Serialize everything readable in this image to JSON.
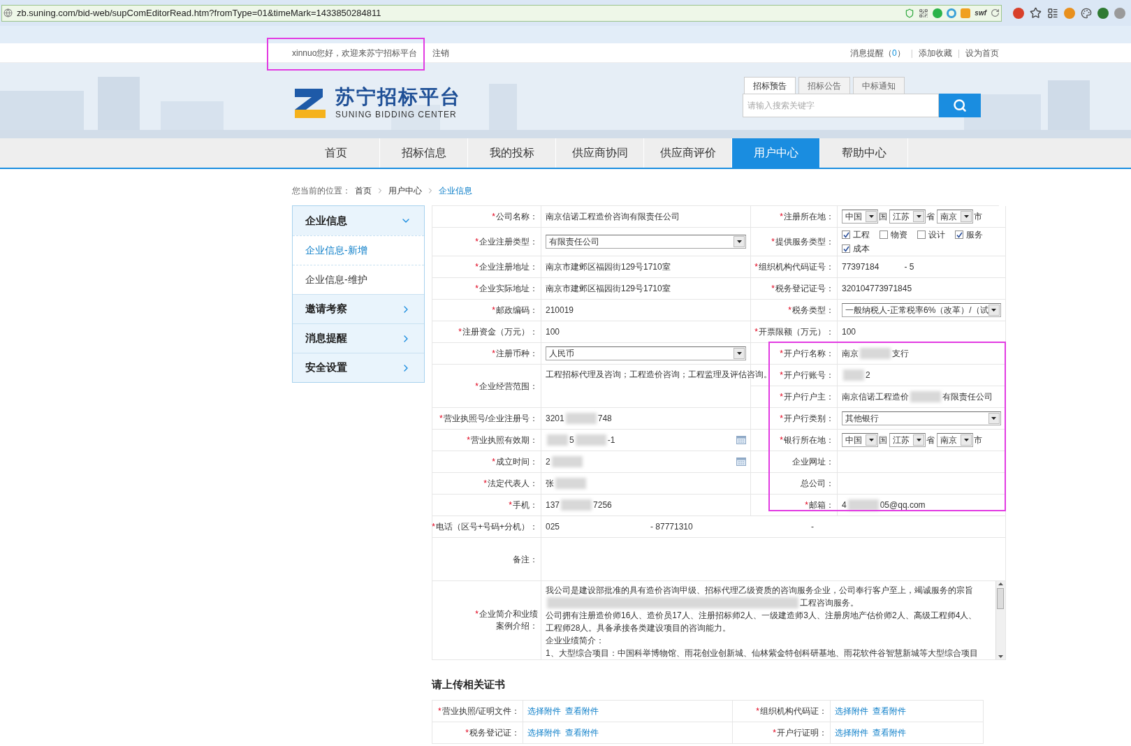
{
  "browser": {
    "url": "zb.suning.com/bid-web/supComEditorRead.htm?fromType=01&timeMark=1433850284811",
    "swf_label": "swf"
  },
  "top_bar": {
    "greeting": "xinnuo您好，欢迎来苏宁招标平台",
    "greeting_highlighted": true,
    "logout": "注销",
    "messages_label": "消息提醒（",
    "messages_count": "0",
    "messages_close": "）",
    "separator_1": "|",
    "favorite": "添加收藏",
    "separator_2": "|",
    "homepage": "设为首页"
  },
  "header": {
    "logo_cn": "苏宁招标平台",
    "logo_en": "SUNING BIDDING CENTER",
    "search_tabs": [
      {
        "label": "招标预告",
        "selected": true
      },
      {
        "label": "招标公告",
        "selected": false
      },
      {
        "label": "中标通知",
        "selected": false
      }
    ],
    "search": {
      "placeholder": "请输入搜索关键字"
    }
  },
  "nav": [
    {
      "label": "首页",
      "selected": false
    },
    {
      "label": "招标信息",
      "selected": false
    },
    {
      "label": "我的投标",
      "selected": false
    },
    {
      "label": "供应商协同",
      "selected": false
    },
    {
      "label": "供应商评价",
      "selected": false
    },
    {
      "label": "用户中心",
      "selected": true
    },
    {
      "label": "帮助中心",
      "selected": false
    }
  ],
  "breadcrumb": {
    "prefix": "您当前的位置：",
    "items": [
      "首页",
      "用户中心",
      "企业信息"
    ]
  },
  "sidebar": [
    {
      "label": "企业信息",
      "expanded": true,
      "children": [
        {
          "label": "企业信息-新增",
          "selected": true
        },
        {
          "label": "企业信息-维护",
          "selected": false
        }
      ]
    },
    {
      "label": "邀请考察",
      "expanded": false
    },
    {
      "label": "消息提醒",
      "expanded": false
    },
    {
      "label": "安全设置",
      "expanded": false
    }
  ],
  "form": {
    "bank_block_highlighted": true,
    "left": [
      {
        "required_mark": "*",
        "label": "公司名称：",
        "kind": "text",
        "value": "南京信诺工程造价咨询有限责任公司"
      },
      {
        "required_mark": "*",
        "label": "企业注册类型：",
        "kind": "select",
        "value": "有限责任公司"
      },
      {
        "required_mark": "*",
        "label": "企业注册地址：",
        "kind": "text",
        "value": "南京市建邺区福园街129号1710室"
      },
      {
        "required_mark": "*",
        "label": "企业实际地址：",
        "kind": "text",
        "value": "南京市建邺区福园街129号1710室"
      },
      {
        "required_mark": "*",
        "label": "邮政编码：",
        "kind": "text",
        "value": "210019"
      },
      {
        "required_mark": "*",
        "label": "注册资金（万元）：",
        "kind": "text",
        "value": "100"
      },
      {
        "required_mark": "*",
        "label": "注册币种：",
        "kind": "select",
        "value": "人民币"
      },
      {
        "required_mark": "*",
        "label": "企业经营范围：",
        "kind": "multiline",
        "value": "工程招标代理及咨询；工程造价咨询；工程监理及评估咨询。"
      },
      {
        "required_mark": "*",
        "label": "营业执照号/企业注册号：",
        "kind": "redacted",
        "parts": [
          {
            "kind": "text",
            "text": "3201"
          },
          {
            "kind": "blur"
          },
          {
            "kind": "text",
            "text": "748"
          }
        ]
      },
      {
        "required_mark": "*",
        "label": "营业执照有效期：",
        "kind": "date",
        "parts": [
          {
            "kind": "blur"
          },
          {
            "kind": "text",
            "text": "5"
          },
          {
            "kind": "blur"
          },
          {
            "kind": "text",
            "text": "-1"
          }
        ]
      },
      {
        "required_mark": "*",
        "label": "成立时间：",
        "kind": "date",
        "parts": [
          {
            "kind": "text",
            "text": "2"
          },
          {
            "kind": "blur"
          }
        ]
      },
      {
        "required_mark": "*",
        "label": "法定代表人：",
        "kind": "redacted",
        "parts": [
          {
            "kind": "text",
            "text": "张"
          },
          {
            "kind": "blur"
          }
        ]
      },
      {
        "required_mark": "*",
        "label": "手机：",
        "kind": "redacted",
        "parts": [
          {
            "kind": "text",
            "text": "137"
          },
          {
            "kind": "blur"
          },
          {
            "kind": "text",
            "text": "7256"
          }
        ]
      }
    ],
    "right": [
      {
        "required_mark": "*",
        "label": "注册所在地：",
        "kind": "location",
        "selects": [
          {
            "value": "中国",
            "suffix": "国"
          },
          {
            "value": "江苏",
            "suffix": "省"
          },
          {
            "value": "南京",
            "suffix": "市"
          }
        ]
      },
      {
        "required_mark": "*",
        "label": "提供服务类型：",
        "kind": "checkboxes",
        "options": [
          {
            "label": "工程",
            "checked": true
          },
          {
            "label": "物资",
            "checked": false
          },
          {
            "label": "设计",
            "checked": false
          },
          {
            "label": "服务",
            "checked": true
          },
          {
            "label": "成本",
            "checked": true
          }
        ]
      },
      {
        "required_mark": "*",
        "label": "组织机构代码证号：",
        "kind": "pair",
        "value": "77397184",
        "value_2": "- 5"
      },
      {
        "required_mark": "*",
        "label": "税务登记证号：",
        "kind": "text",
        "value": "320104773971845"
      },
      {
        "required_mark": "*",
        "label": "税务类型：",
        "kind": "select",
        "value": "一般纳税人-正常税率6%（改革）/（试"
      },
      {
        "required_mark": "*",
        "label": "开票限额（万元）：",
        "kind": "text",
        "value": "100"
      },
      {
        "required_mark": "*",
        "label": "开户行名称：",
        "kind": "redacted",
        "parts": [
          {
            "kind": "text",
            "text": "南京"
          },
          {
            "kind": "blur"
          },
          {
            "kind": "text",
            "text": "支行"
          }
        ]
      },
      {
        "required_mark": "*",
        "label": "开户行账号：",
        "kind": "redacted",
        "parts": [
          {
            "kind": "blur"
          },
          {
            "kind": "text",
            "text": "2"
          }
        ]
      },
      {
        "required_mark": "*",
        "label": "开户行户主：",
        "kind": "redacted",
        "parts": [
          {
            "kind": "text",
            "text": "南京信诺工程造价"
          },
          {
            "kind": "blur"
          },
          {
            "kind": "text",
            "text": "有限责任公司"
          }
        ]
      },
      {
        "required_mark": "*",
        "label": "开户行类别：",
        "kind": "select",
        "value": "其他银行"
      },
      {
        "required_mark": "*",
        "label": "银行所在地：",
        "kind": "location",
        "selects": [
          {
            "value": "中国",
            "suffix": "国"
          },
          {
            "value": "江苏",
            "suffix": "省"
          },
          {
            "value": "南京",
            "suffix": "市"
          }
        ]
      },
      {
        "label": "企业网址：",
        "kind": "empty"
      },
      {
        "label": "总公司：",
        "kind": "empty"
      },
      {
        "required_mark": "*",
        "label": "邮箱：",
        "kind": "redacted",
        "parts": [
          {
            "kind": "text",
            "text": "4"
          },
          {
            "kind": "blur"
          },
          {
            "kind": "text",
            "text": "05@qq.com"
          }
        ]
      }
    ],
    "phone": {
      "required_mark": "*",
      "label": "电话（区号+号码+分机）：",
      "area": "025",
      "number": "- 87771310",
      "extension": "-"
    },
    "remark": {
      "label": "备注："
    },
    "intro": {
      "required_mark": "*",
      "label": "企业简介和业绩",
      "label_2": "案例介绍：",
      "lines": [
        [
          {
            "kind": "text",
            "text": "我公司是建设部批准的具有造价咨询甲级、招标代理乙级资质的咨询服务企业，公司奉行客户至上，竭诚服务的宗旨"
          }
        ],
        [
          {
            "kind": "blur"
          },
          {
            "kind": "text",
            "text": "工程咨询服务。"
          }
        ],
        [
          {
            "kind": "text",
            "text": "公司拥有注册造价师16人、造价员17人、注册招标师2人、一级建造师3人、注册房地产估价师2人、高级工程师4人、"
          }
        ],
        [
          {
            "kind": "text",
            "text": "工程师28人。具备承接各类建设项目的咨询能力。"
          }
        ],
        [
          {
            "kind": "text",
            "text": "企业业绩简介："
          }
        ],
        [
          {
            "kind": "text",
            "text": "1、大型综合项目：中国科举博物馆、雨花创业创新城、仙林紫金特创科研基地、雨花软件谷智慧新城等大型综合项目"
          }
        ]
      ]
    }
  },
  "uploads": {
    "title": "请上传相关证书",
    "items": [
      {
        "required_mark": "*",
        "label": "营业执照/证明文件：",
        "choose": "选择附件",
        "view": "查看附件"
      },
      {
        "required_mark": "*",
        "label": "组织机构代码证：",
        "choose": "选择附件",
        "view": "查看附件"
      },
      {
        "required_mark": "*",
        "label": "税务登记证：",
        "choose": "选择附件",
        "view": "查看附件"
      },
      {
        "required_mark": "*",
        "label": "开户行证明：",
        "choose": "选择附件",
        "view": "查看附件"
      }
    ]
  }
}
